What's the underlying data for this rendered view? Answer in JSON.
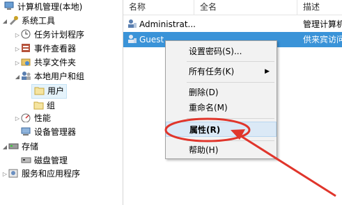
{
  "tree": {
    "root": "计算机管理(本地)",
    "items": [
      {
        "label": "系统工具",
        "icon": "tools-icon"
      },
      {
        "label": "任务计划程序",
        "icon": "clock-icon"
      },
      {
        "label": "事件查看器",
        "icon": "event-viewer-icon"
      },
      {
        "label": "共享文件夹",
        "icon": "shared-folder-icon"
      },
      {
        "label": "本地用户和组",
        "icon": "users-groups-icon"
      },
      {
        "label": "用户",
        "icon": "folder-icon"
      },
      {
        "label": "组",
        "icon": "folder-icon"
      },
      {
        "label": "性能",
        "icon": "performance-icon"
      },
      {
        "label": "设备管理器",
        "icon": "device-manager-icon"
      },
      {
        "label": "存储",
        "icon": "storage-icon"
      },
      {
        "label": "磁盘管理",
        "icon": "disk-icon"
      },
      {
        "label": "服务和应用程序",
        "icon": "services-icon"
      }
    ]
  },
  "list": {
    "columns": [
      "名称",
      "全名",
      "描述"
    ],
    "rows": [
      {
        "name": "Administrat...",
        "fullname": "",
        "desc": "管理计算机"
      },
      {
        "name": "Guest",
        "fullname": "",
        "desc": "供来宾访问"
      }
    ]
  },
  "context_menu": {
    "items": [
      "设置密码(S)...",
      "所有任务(K)",
      "删除(D)",
      "重命名(M)",
      "属性(R)",
      "帮助(H)"
    ],
    "submenu_arrow": "▶"
  },
  "annotation_color": "#e0352b",
  "selection_color": "#3a93d8"
}
